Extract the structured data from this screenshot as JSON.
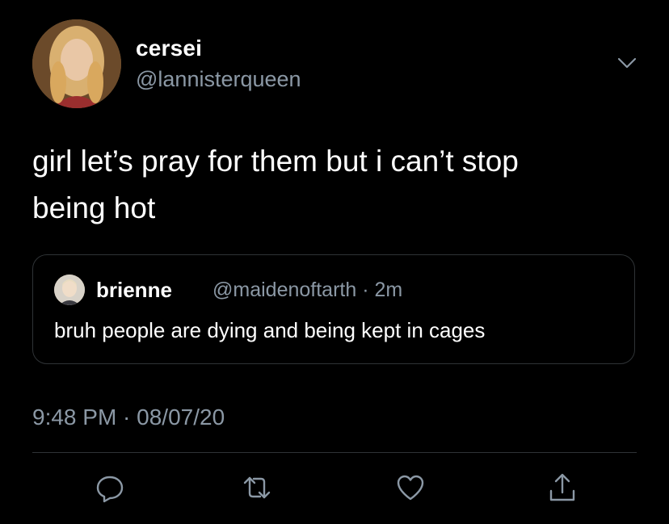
{
  "author": {
    "display_name": "cersei",
    "handle": "@lannisterqueen"
  },
  "tweet": {
    "text": "girl let’s pray for them but i can’t stop\nbeing hot",
    "timestamp": "9:48 PM · 08/07/20"
  },
  "quoted_tweet": {
    "display_name": "brienne",
    "handle_and_time": "@maidenoftarth · 2m",
    "text": "bruh people are dying and being kept in cages"
  },
  "icons": {
    "menu": "chevron-down-icon",
    "reply": "reply-icon",
    "retweet": "retweet-icon",
    "like": "heart-icon",
    "share": "share-icon"
  },
  "colors": {
    "background": "#000000",
    "text": "#ffffff",
    "secondary_text": "#8b98a5",
    "border": "#2f3336",
    "icon": "#8b98a5"
  }
}
